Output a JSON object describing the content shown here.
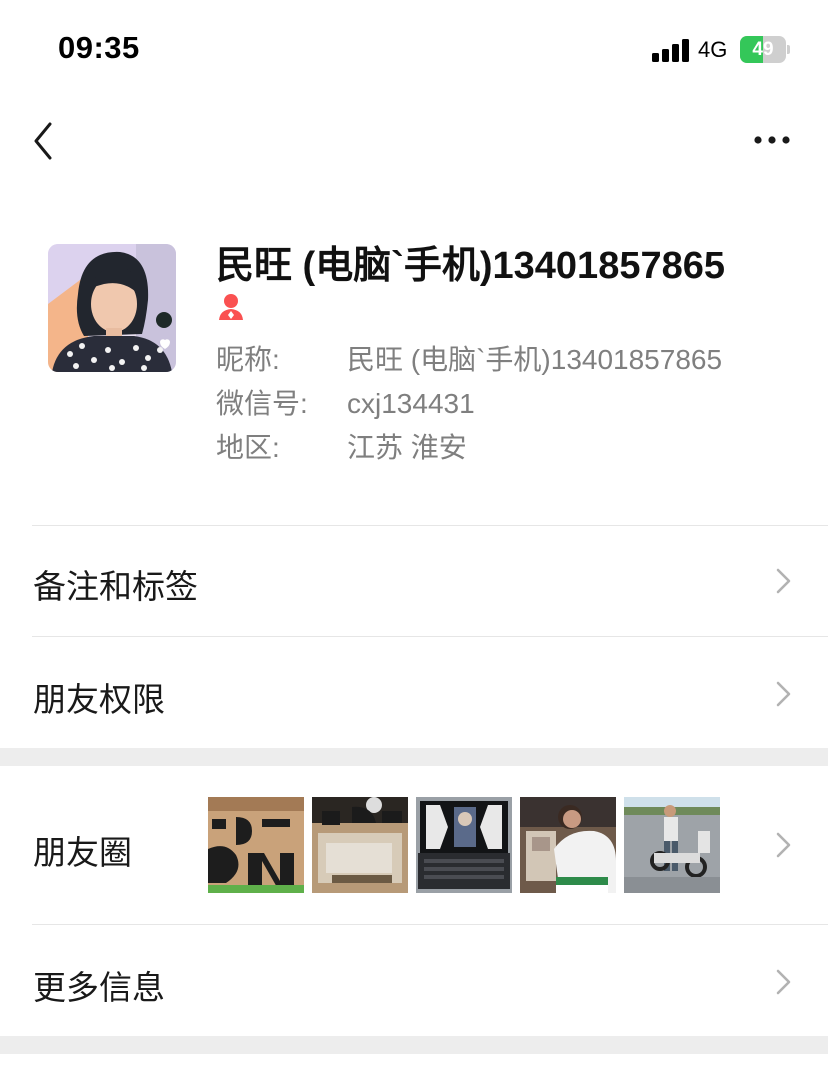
{
  "status_bar": {
    "time": "09:35",
    "network": "4G",
    "battery_level": "49",
    "battery_fill_fraction": 0.49,
    "charging": true
  },
  "nav": {
    "back_icon": "chevron-left-icon",
    "more_icon": "more-horizontal-icon"
  },
  "profile": {
    "name": "民旺 (电脑`手机)13401857865",
    "gender_icon": "female-icon",
    "gender_color": "#fa5151",
    "nickname_label": "昵称:",
    "nickname_value": "民旺 (电脑`手机)13401857865",
    "wechat_id_label": "微信号:",
    "wechat_id_value": "cxj134431",
    "region_label": "地区:",
    "region_value": "江苏 淮安"
  },
  "menu": {
    "remarks_tags": "备注和标签",
    "friend_permissions": "朋友权限",
    "moments": "朋友圈",
    "more_info": "更多信息"
  },
  "moments_thumbnails": [
    "thumb-box-lettering",
    "thumb-box-open",
    "thumb-laptop",
    "thumb-person-at-desk",
    "thumb-person-scooter"
  ],
  "colors": {
    "background": "#ffffff",
    "separator_band": "#ededed",
    "divider": "#e6e6e6",
    "secondary_text": "#7f7f7f",
    "chevron": "#b2b2b2",
    "battery_green": "#34c759"
  }
}
